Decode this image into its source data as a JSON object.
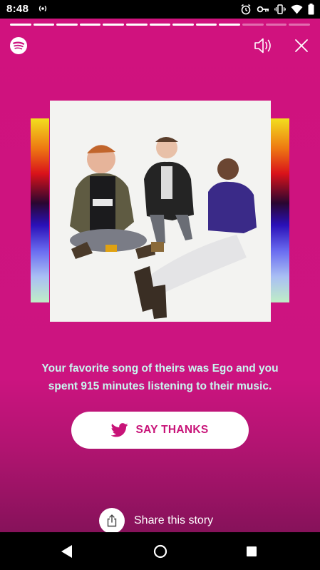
{
  "status_bar": {
    "time": "8:48",
    "icons": [
      "radio-icon",
      "alarm-icon",
      "vpn-key-icon",
      "vibrate-icon",
      "wifi-icon",
      "battery-icon"
    ]
  },
  "story": {
    "progress": {
      "total_segments": 13,
      "completed_segments": 10
    },
    "brand_icon": "spotify-logo-icon",
    "text_part1": "Your favorite song of theirs was Ego and you",
    "text_part2": "spent 915 minutes listening to their music.",
    "say_thanks_label": "SAY THANKS",
    "say_thanks_icon": "twitter-bird-icon",
    "share_label": "Share this story",
    "share_icon": "share-icon"
  },
  "colors": {
    "background": "#cc1480",
    "text_accent": "#c9f7f0",
    "button_bg": "#ffffff",
    "button_text": "#c81378"
  },
  "nav_bar": {
    "icons": [
      "back-icon",
      "home-icon",
      "recents-icon"
    ]
  }
}
